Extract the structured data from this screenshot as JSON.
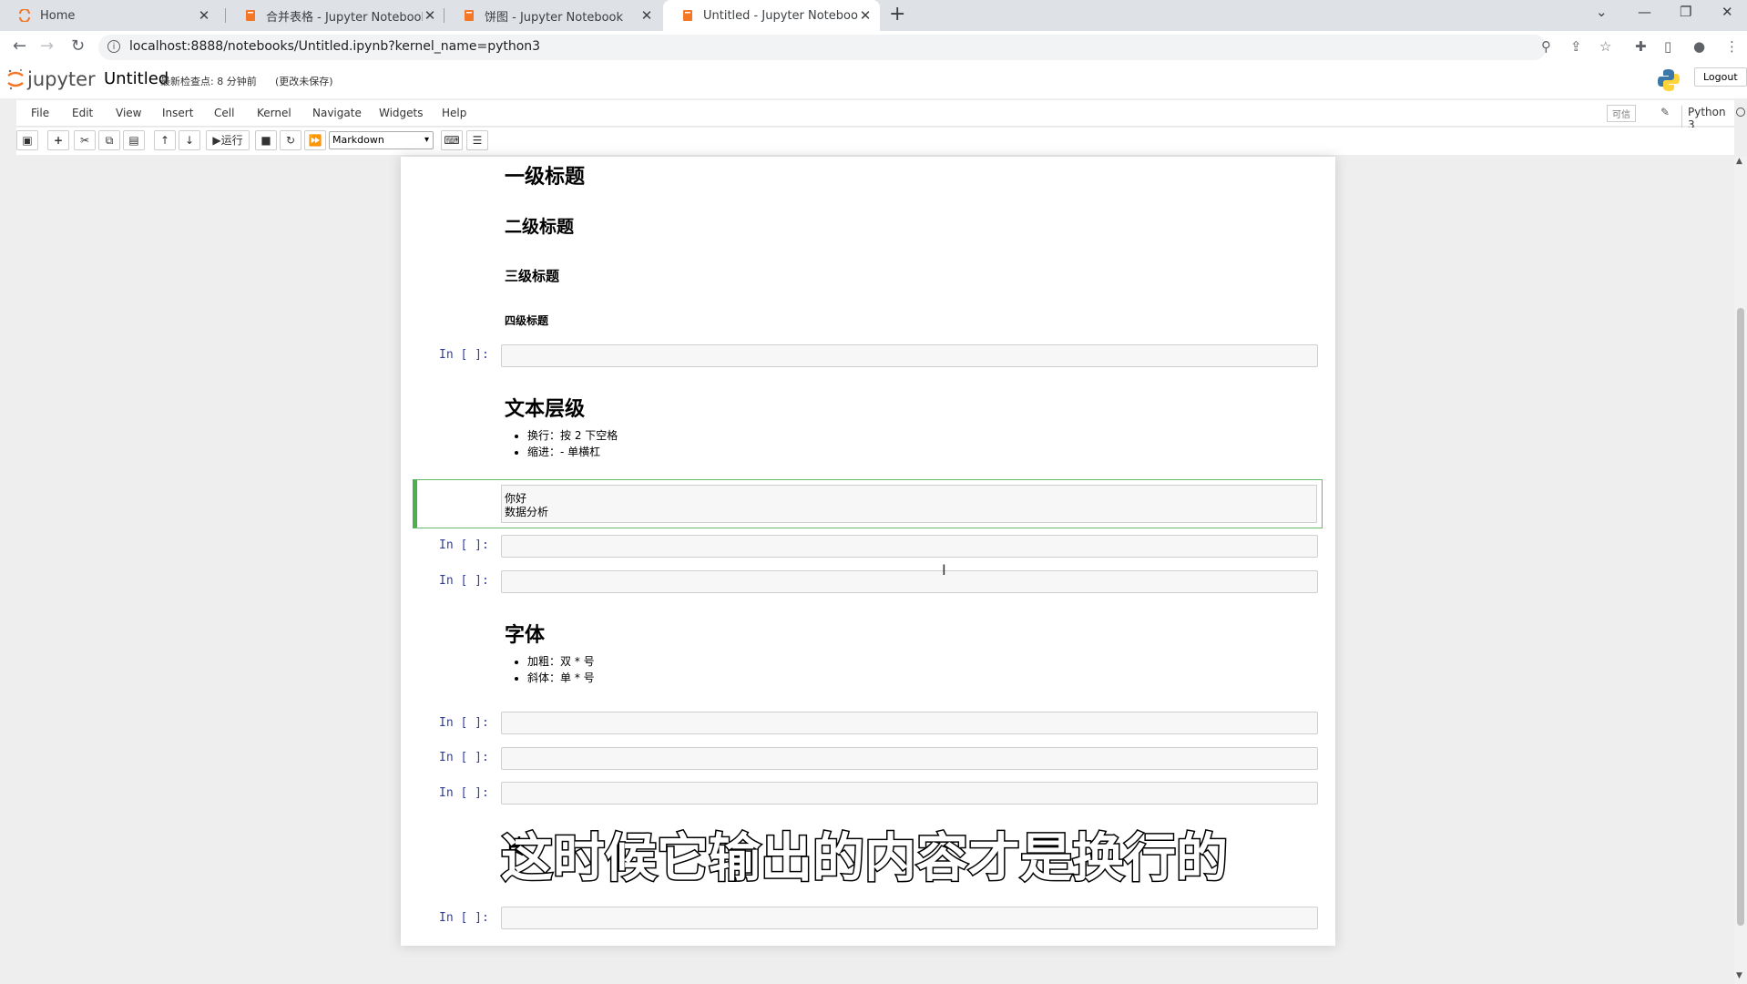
{
  "browser": {
    "tabs": [
      {
        "title": "Home",
        "icon": "jupyter-logo-icon"
      },
      {
        "title": "合并表格 - Jupyter Notebook",
        "icon": "notebook-icon"
      },
      {
        "title": "饼图 - Jupyter Notebook",
        "icon": "notebook-icon"
      },
      {
        "title": "Untitled - Jupyter Notebook",
        "icon": "notebook-icon"
      }
    ],
    "url": "localhost:8888/notebooks/Untitled.ipynb?kernel_name=python3"
  },
  "jupyter": {
    "logo_text": "jupyter",
    "notebook_name": "Untitled",
    "checkpoint": "最新检查点: 8 分钟前",
    "autosave": "(更改未保存)",
    "logout": "Logout",
    "menu": [
      "File",
      "Edit",
      "View",
      "Insert",
      "Cell",
      "Kernel",
      "Navigate",
      "Widgets",
      "Help"
    ],
    "trusted": "可信",
    "kernel_name": "Python 3",
    "run_label": "运行",
    "cell_type": "Markdown"
  },
  "notebook": {
    "prompt": "In [ ]:",
    "headings": {
      "h1": "一级标题",
      "h2": "二级标题",
      "h3": "三级标题",
      "h4": "四级标题"
    },
    "text_section": {
      "title": "文本层级",
      "items": [
        "换行：按 2 下空格",
        "缩进：- 单横杠"
      ]
    },
    "editing_cell": {
      "line1": "你好",
      "line2": "数据分析"
    },
    "font_section": {
      "title": "字体",
      "items": [
        "加粗：双 * 号",
        "斜体：单 * 号"
      ]
    },
    "partial_heading": "其"
  },
  "subtitle": "这时候它输出的内容才是换行的"
}
